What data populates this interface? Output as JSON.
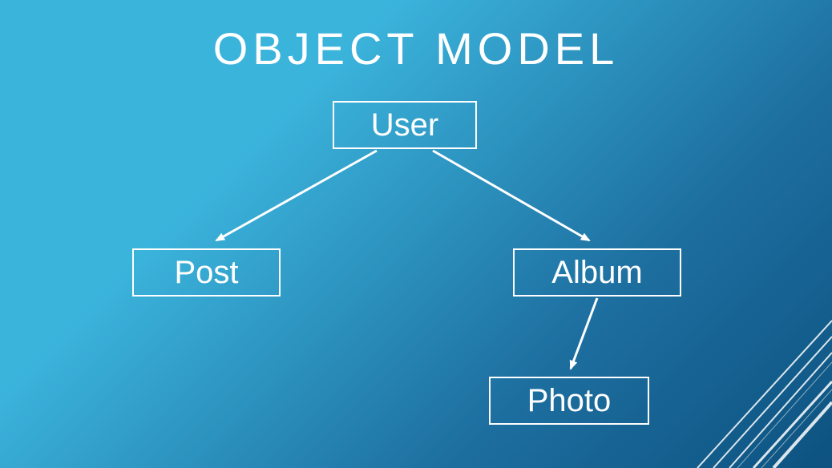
{
  "title": "OBJECT MODEL",
  "nodes": {
    "user": "User",
    "post": "Post",
    "album": "Album",
    "photo": "Photo"
  }
}
